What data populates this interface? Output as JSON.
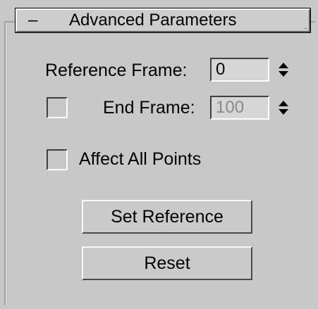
{
  "rollout": {
    "collapse_symbol": "–",
    "title": "Advanced Parameters"
  },
  "reference_frame": {
    "label": "Reference Frame:",
    "value": "0",
    "icon": "spinner-arrows-icon"
  },
  "end_frame": {
    "checked": false,
    "label": "End Frame:",
    "value": "100",
    "enabled": false,
    "icon": "spinner-arrows-icon"
  },
  "affect_all_points": {
    "checked": false,
    "label": "Affect All Points"
  },
  "buttons": {
    "set_reference": "Set Reference",
    "reset": "Reset"
  }
}
